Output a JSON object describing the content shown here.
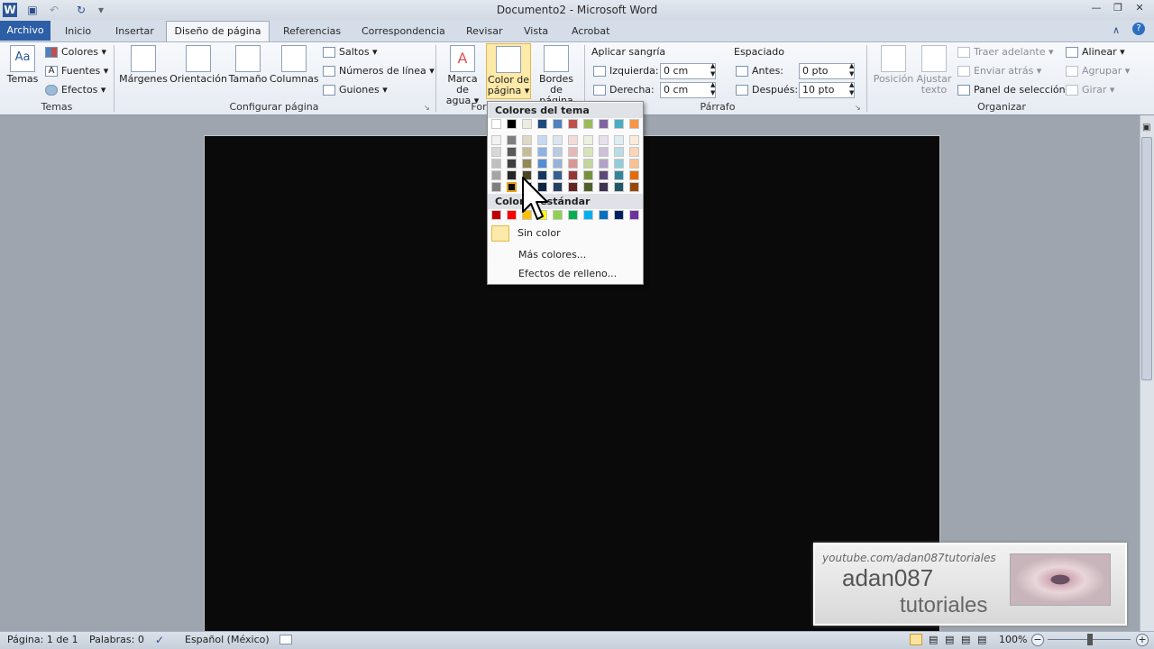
{
  "window": {
    "title": "Documento2 - Microsoft Word"
  },
  "tabs": [
    {
      "label": "Archivo"
    },
    {
      "label": "Inicio"
    },
    {
      "label": "Insertar"
    },
    {
      "label": "Diseño de página"
    },
    {
      "label": "Referencias"
    },
    {
      "label": "Correspondencia"
    },
    {
      "label": "Revisar"
    },
    {
      "label": "Vista"
    },
    {
      "label": "Acrobat"
    }
  ],
  "ribbon": {
    "temas": {
      "temas_label": "Temas",
      "colores": "Colores",
      "fuentes": "Fuentes",
      "efectos": "Efectos",
      "group": "Temas"
    },
    "configurar": {
      "margenes": "Márgenes",
      "orientacion": "Orientación",
      "tamano": "Tamaño",
      "columnas": "Columnas",
      "saltos": "Saltos",
      "numeros": "Números de línea",
      "guiones": "Guiones",
      "group": "Configurar página"
    },
    "fondo": {
      "marca1": "Marca de",
      "marca2": "agua",
      "color1": "Color de",
      "color2": "página",
      "bordes1": "Bordes",
      "bordes2": "de página",
      "group": "For"
    },
    "parrafo": {
      "sangria": "Aplicar sangría",
      "izquierda": "Izquierda:",
      "izq_val": "0 cm",
      "derecha": "Derecha:",
      "der_val": "0 cm",
      "espaciado": "Espaciado",
      "antes": "Antes:",
      "antes_val": "0 pto",
      "despues": "Después:",
      "despues_val": "10 pto",
      "group": "Párrafo"
    },
    "organizar": {
      "posicion": "Posición",
      "ajustar1": "Ajustar",
      "ajustar2": "texto",
      "traer": "Traer adelante",
      "enviar": "Enviar atrás",
      "panel": "Panel de selección",
      "alinear": "Alinear",
      "agrupar": "Agrupar",
      "girar": "Girar",
      "group": "Organizar"
    }
  },
  "dropdown": {
    "theme_header": "Colores del tema",
    "standard_header": "Colores estándar",
    "no_color": "Sin color",
    "more_colors": "Más colores...",
    "fill_effects": "Efectos de relleno...",
    "theme_top": [
      "#ffffff",
      "#000000",
      "#eeece1",
      "#1f497d",
      "#4f81bd",
      "#c0504d",
      "#9bbb59",
      "#8064a2",
      "#4bacc6",
      "#f79646"
    ],
    "theme_shades": [
      [
        "#f2f2f2",
        "#7f7f7f",
        "#ddd9c3",
        "#c6d9f0",
        "#dbe5f1",
        "#f2dcdb",
        "#ebf1dd",
        "#e5e0ec",
        "#dbeef3",
        "#fdeada"
      ],
      [
        "#d8d8d8",
        "#595959",
        "#c4bd97",
        "#8db3e2",
        "#b8cce4",
        "#e5b9b7",
        "#d7e3bc",
        "#ccc1d9",
        "#b7dde8",
        "#fbd5b5"
      ],
      [
        "#bfbfbf",
        "#3f3f3f",
        "#938953",
        "#548dd4",
        "#95b3d7",
        "#d99694",
        "#c3d69b",
        "#b2a2c7",
        "#92cddc",
        "#fac08f"
      ],
      [
        "#a5a5a5",
        "#262626",
        "#494429",
        "#17365d",
        "#366092",
        "#953734",
        "#76923c",
        "#5f497a",
        "#31859b",
        "#e36c09"
      ],
      [
        "#7f7f7f",
        "#0c0c0c",
        "#1d1b10",
        "#0f243e",
        "#244061",
        "#632423",
        "#4f6128",
        "#3f3151",
        "#205867",
        "#974806"
      ]
    ],
    "standard": [
      "#c00000",
      "#ff0000",
      "#ffc000",
      "#ffff00",
      "#92d050",
      "#00b050",
      "#00b0f0",
      "#0070c0",
      "#002060",
      "#7030a0"
    ],
    "selected": {
      "row": 4,
      "col": 1
    }
  },
  "status": {
    "pagina": "Página: 1 de 1",
    "palabras": "Palabras: 0",
    "idioma": "Español (México)",
    "zoom": "100%"
  },
  "watermark": {
    "url": "youtube.com/adan087tutoriales",
    "name": "adan087",
    "tag": "tutoriales"
  }
}
